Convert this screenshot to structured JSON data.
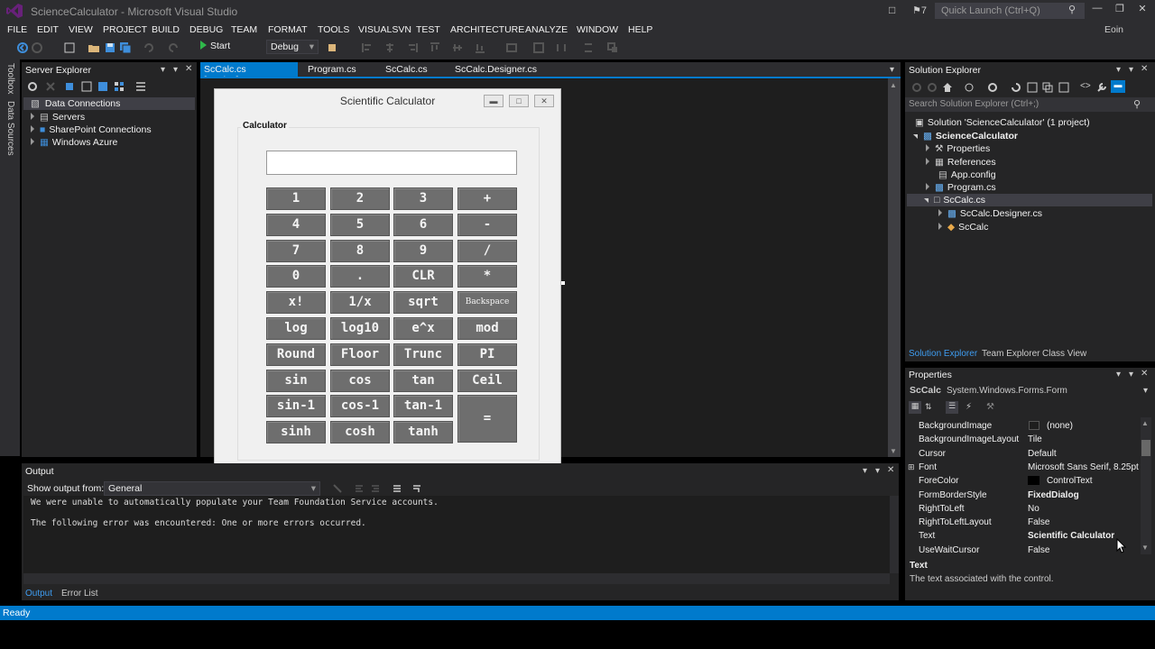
{
  "window": {
    "title": "ScienceCalculator - Microsoft Visual Studio",
    "notification_count": "7",
    "quick_launch_placeholder": "Quick Launch (Ctrl+Q)",
    "user": "Eoin"
  },
  "menu": [
    "FILE",
    "EDIT",
    "VIEW",
    "PROJECT",
    "BUILD",
    "DEBUG",
    "TEAM",
    "FORMAT",
    "TOOLS",
    "VISUALSVN",
    "TEST",
    "ARCHITECTURE",
    "ANALYZE",
    "WINDOW",
    "HELP"
  ],
  "toolbar": {
    "start_label": "Start",
    "configuration": "Debug"
  },
  "side_tabs": {
    "toolbox": "Toolbox",
    "data_sources": "Data Sources"
  },
  "server_explorer": {
    "title": "Server Explorer",
    "items": [
      "Data Connections",
      "Servers",
      "SharePoint Connections",
      "Windows Azure"
    ]
  },
  "doc_tabs": [
    "ScCalc.cs [Design]",
    "Program.cs",
    "ScCalc.cs",
    "ScCalc.Designer.cs"
  ],
  "calculator": {
    "form_title": "Scientific Calculator",
    "group_label": "Calculator",
    "display_value": "",
    "buttons": [
      [
        "1",
        "2",
        "3",
        "+"
      ],
      [
        "4",
        "5",
        "6",
        "-"
      ],
      [
        "7",
        "8",
        "9",
        "/"
      ],
      [
        "0",
        ".",
        "CLR",
        "*"
      ],
      [
        "x!",
        "1/x",
        "sqrt",
        "Backspace"
      ],
      [
        "log",
        "log10",
        "e^x",
        "mod"
      ],
      [
        "Round",
        "Floor",
        "Trunc",
        "PI"
      ],
      [
        "sin",
        "cos",
        "tan",
        "Ceil"
      ],
      [
        "sin-1",
        "cos-1",
        "tan-1"
      ],
      [
        "sinh",
        "cosh",
        "tanh"
      ]
    ],
    "equals": "="
  },
  "solution_explorer": {
    "title": "Solution Explorer",
    "search_placeholder": "Search Solution Explorer (Ctrl+;)",
    "tree": [
      "Solution 'ScienceCalculator' (1 project)",
      "ScienceCalculator",
      "Properties",
      "References",
      "App.config",
      "Program.cs",
      "ScCalc.cs",
      "ScCalc.Designer.cs",
      "ScCalc"
    ],
    "tabs": [
      "Solution Explorer",
      "Team Explorer",
      "Class View"
    ]
  },
  "properties": {
    "title": "Properties",
    "object_name": "ScCalc",
    "object_type": "System.Windows.Forms.Form",
    "rows": [
      {
        "name": "BackgroundImage",
        "value": "(none)"
      },
      {
        "name": "BackgroundImageLayout",
        "value": "Tile"
      },
      {
        "name": "Cursor",
        "value": "Default"
      },
      {
        "name": "Font",
        "value": "Microsoft Sans Serif, 8.25pt"
      },
      {
        "name": "ForeColor",
        "value": "ControlText"
      },
      {
        "name": "FormBorderStyle",
        "value": "FixedDialog"
      },
      {
        "name": "RightToLeft",
        "value": "No"
      },
      {
        "name": "RightToLeftLayout",
        "value": "False"
      },
      {
        "name": "Text",
        "value": "Scientific Calculator"
      },
      {
        "name": "UseWaitCursor",
        "value": "False"
      }
    ],
    "desc_title": "Text",
    "desc_text": "The text associated with the control."
  },
  "output": {
    "title": "Output",
    "show_from_label": "Show output from:",
    "source": "General",
    "lines": [
      "We were unable to automatically populate your Team Foundation Service accounts.",
      "The following error was encountered: One or more errors occurred."
    ],
    "tabs": [
      "Output",
      "Error List"
    ]
  },
  "status": {
    "text": "Ready"
  },
  "colors": {
    "accent": "#007acc",
    "chrome": "#2d2d30",
    "panel": "#252526",
    "editor": "#1e1e1e",
    "button": "#6e6e6e"
  }
}
